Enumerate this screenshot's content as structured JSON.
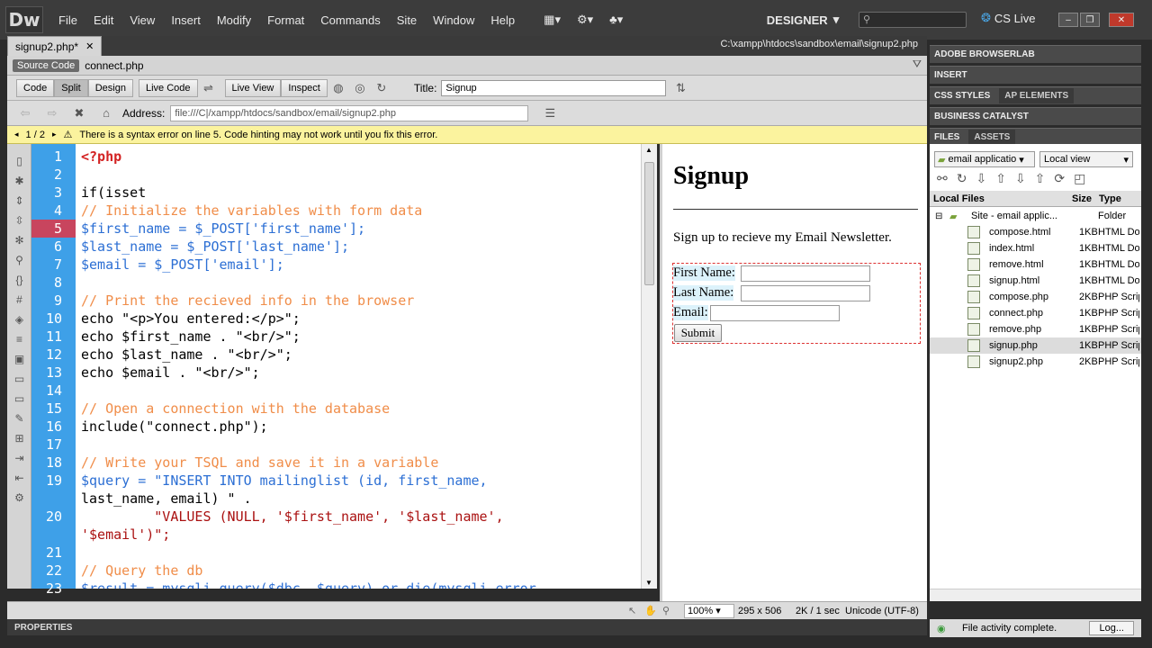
{
  "app": {
    "logo": "Dw",
    "menu": [
      "File",
      "Edit",
      "View",
      "Insert",
      "Modify",
      "Format",
      "Commands",
      "Site",
      "Window",
      "Help"
    ],
    "workspace": "DESIGNER",
    "cs_live": "CS Live"
  },
  "document": {
    "tab_name": "signup2.php*",
    "path": "C:\\xampp\\htdocs\\sandbox\\email\\signup2.php",
    "related": {
      "source_code": "Source Code",
      "file": "connect.php"
    },
    "toolbar": {
      "code": "Code",
      "split": "Split",
      "design": "Design",
      "live_code": "Live Code",
      "live_view": "Live View",
      "inspect": "Inspect",
      "title_label": "Title:",
      "title_value": "Signup"
    },
    "address": {
      "label": "Address:",
      "value": "file:///C|/xampp/htdocs/sandbox/email/signup2.php"
    },
    "error": {
      "counter": "1 / 2",
      "message": "There is a syntax error on line 5.  Code hinting may not work until you fix this error."
    }
  },
  "code_lines": [
    {
      "n": "1",
      "t": "<?php"
    },
    {
      "n": "2",
      "t": ""
    },
    {
      "n": "3",
      "t": "if(isset"
    },
    {
      "n": "4",
      "t": "// Initialize the variables with form data"
    },
    {
      "n": "5",
      "t": "$first_name = $_POST['first_name'];"
    },
    {
      "n": "6",
      "t": "$last_name = $_POST['last_name'];"
    },
    {
      "n": "7",
      "t": "$email = $_POST['email'];"
    },
    {
      "n": "8",
      "t": ""
    },
    {
      "n": "9",
      "t": "// Print the recieved info in the browser"
    },
    {
      "n": "10",
      "t": "echo \"<p>You entered:</p>\";"
    },
    {
      "n": "11",
      "t": "echo $first_name . \"<br/>\";"
    },
    {
      "n": "12",
      "t": "echo $last_name . \"<br/>\";"
    },
    {
      "n": "13",
      "t": "echo $email . \"<br/>\";"
    },
    {
      "n": "14",
      "t": ""
    },
    {
      "n": "15",
      "t": "// Open a connection with the database"
    },
    {
      "n": "16",
      "t": "include(\"connect.php\");"
    },
    {
      "n": "17",
      "t": ""
    },
    {
      "n": "18",
      "t": "// Write your TSQL and save it in a variable"
    },
    {
      "n": "19",
      "t": "$query = \"INSERT INTO mailinglist (id, first_name,"
    },
    {
      "n": "",
      "t": "last_name, email) \" ."
    },
    {
      "n": "20",
      "t": "         \"VALUES (NULL, '$first_name', '$last_name',"
    },
    {
      "n": "",
      "t": "'$email')\";"
    },
    {
      "n": "21",
      "t": ""
    },
    {
      "n": "22",
      "t": "// Query the db"
    },
    {
      "n": "23",
      "t": "$result = mysqli_query($dbc, $query) or die(mysqli_error"
    }
  ],
  "design_view": {
    "heading": "Signup",
    "text": "Sign up to recieve my Email Newsletter.",
    "first_name_label": "First Name:",
    "last_name_label": "Last Name:",
    "email_label": "Email:",
    "submit": "Submit"
  },
  "status": {
    "zoom": "100%",
    "size": "295 x 506",
    "weight": "2K / 1 sec",
    "encoding": "Unicode (UTF-8)",
    "properties": "PROPERTIES"
  },
  "panels": {
    "browserlab": "ADOBE BROWSERLAB",
    "insert": "INSERT",
    "css_styles": "CSS STYLES",
    "ap_elements": "AP ELEMENTS",
    "business_catalyst": "BUSINESS CATALYST",
    "files": "FILES",
    "assets": "ASSETS",
    "site_select": "email applicatio",
    "view_select": "Local view",
    "col_local": "Local Files",
    "col_size": "Size",
    "col_type": "Type",
    "site_root": {
      "name": "Site - email applic...",
      "type": "Folder"
    },
    "files_list": [
      {
        "name": "compose.html",
        "size": "1KB",
        "type": "HTML Do"
      },
      {
        "name": "index.html",
        "size": "1KB",
        "type": "HTML Do"
      },
      {
        "name": "remove.html",
        "size": "1KB",
        "type": "HTML Do"
      },
      {
        "name": "signup.html",
        "size": "1KB",
        "type": "HTML Do"
      },
      {
        "name": "compose.php",
        "size": "2KB",
        "type": "PHP Scrip"
      },
      {
        "name": "connect.php",
        "size": "1KB",
        "type": "PHP Scrip"
      },
      {
        "name": "remove.php",
        "size": "1KB",
        "type": "PHP Scrip"
      },
      {
        "name": "signup.php",
        "size": "1KB",
        "type": "PHP Scrip"
      },
      {
        "name": "signup2.php",
        "size": "2KB",
        "type": "PHP Scrip"
      }
    ],
    "file_status": "File activity complete.",
    "log": "Log..."
  }
}
